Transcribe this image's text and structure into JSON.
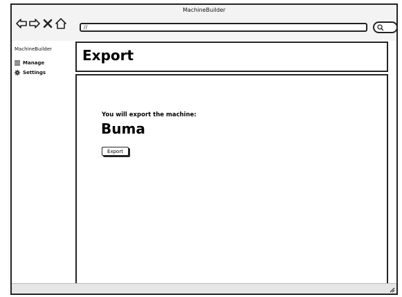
{
  "window": {
    "title": "MachineBuilder"
  },
  "toolbar": {
    "url": "//"
  },
  "sidebar": {
    "brand": "MachineBuilder",
    "items": [
      {
        "label": "Manage",
        "icon": "menu-icon"
      },
      {
        "label": "Settings",
        "icon": "gear-icon"
      }
    ]
  },
  "page": {
    "title": "Export",
    "intro": "You will export the machine:",
    "machine_name": "Buma",
    "export_label": "Export"
  }
}
